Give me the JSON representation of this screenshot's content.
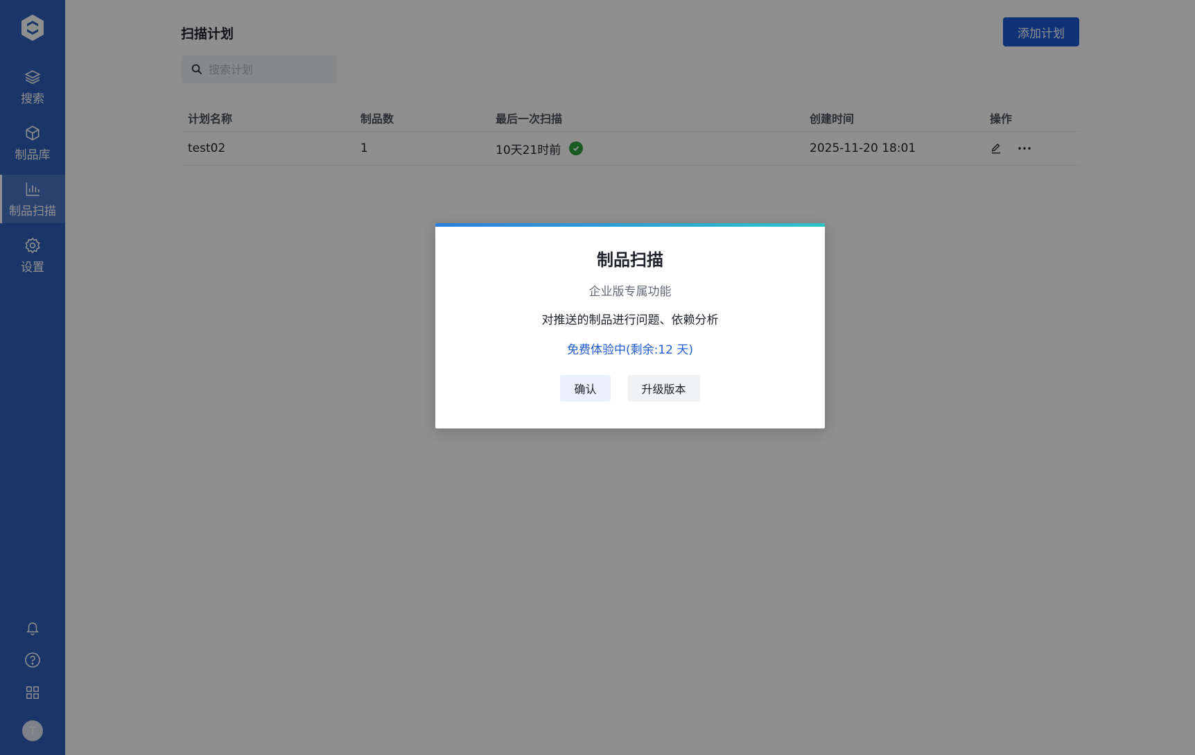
{
  "sidebar": {
    "logo_icon": "brand-logo",
    "items": [
      {
        "label": "搜索",
        "icon": "layers-icon"
      },
      {
        "label": "制品库",
        "icon": "cube-icon"
      },
      {
        "label": "制品扫描",
        "icon": "bar-chart-icon",
        "active": true
      },
      {
        "label": "设置",
        "icon": "gear-icon"
      }
    ],
    "bottom_icons": [
      "bell-icon",
      "help-icon",
      "apps-grid-icon"
    ],
    "avatar_initial": "T"
  },
  "page": {
    "title": "扫描计划",
    "add_button": "添加计划",
    "search_placeholder": "搜索计划"
  },
  "table": {
    "headers": [
      "计划名称",
      "制品数",
      "最后一次扫描",
      "创建时间",
      "操作"
    ],
    "rows": [
      {
        "name": "test02",
        "count": "1",
        "last_scan": "10天21时前",
        "status": "success",
        "created": "2025-11-20 18:01"
      }
    ]
  },
  "modal": {
    "title": "制品扫描",
    "subtitle": "企业版专属功能",
    "description": "对推送的制品进行问题、依赖分析",
    "trial": "免费体验中(剩余:12 天)",
    "confirm": "确认",
    "upgrade": "升级版本"
  },
  "colors": {
    "sidebar": "#2f5fb8",
    "primary": "#1e5cd6",
    "success": "#2ea043"
  }
}
